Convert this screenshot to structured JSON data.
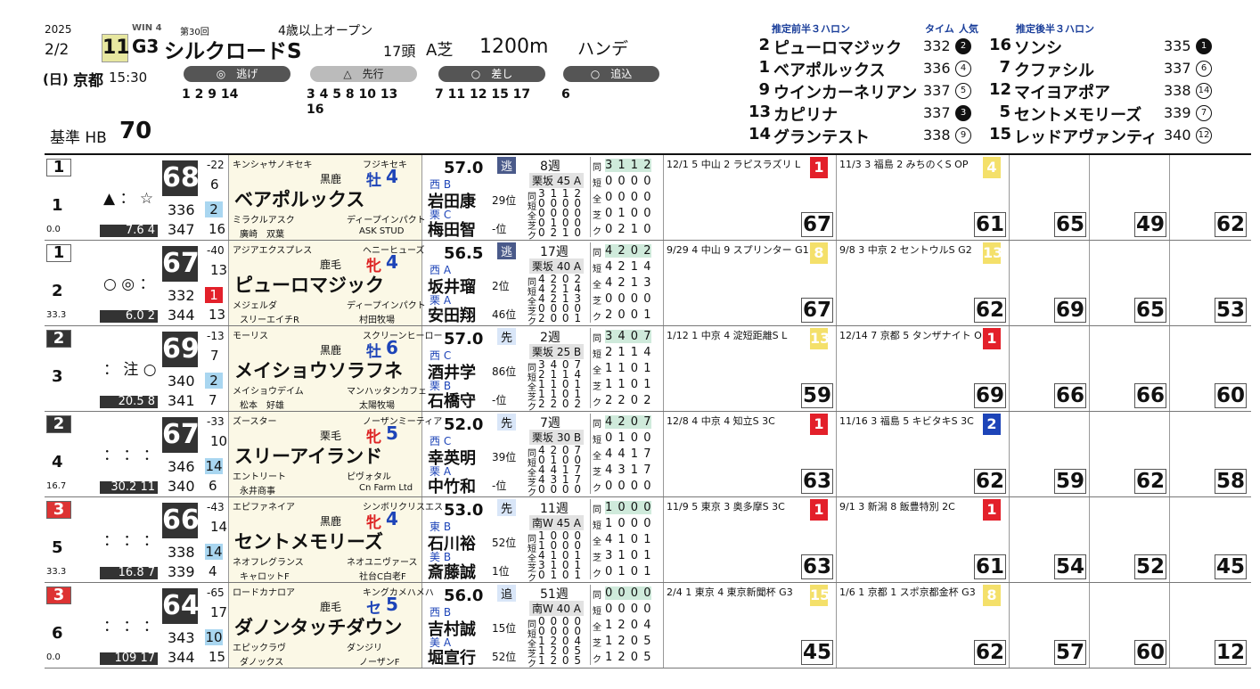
{
  "header": {
    "year": "2025",
    "date": "2/2",
    "day": "(日)",
    "venue": "京都",
    "time": "15:30",
    "win_label": "WIN 4",
    "edition": "第30回",
    "race_number": "11",
    "grade": "G3",
    "race_name": "シルクロードS",
    "conditions": "4歳以上オープン",
    "field": "17頭",
    "course_type": "A芝",
    "distance": "1200m",
    "weight_rule": "ハンデ",
    "base_label": "基準 HB",
    "base_value": "70"
  },
  "styles": [
    {
      "label": "◎　逃げ",
      "horses": "1 2 9 14"
    },
    {
      "label": "△　先行",
      "horses": "3 4 5 8 10 13 16"
    },
    {
      "label": "○　差し",
      "horses": "7 11 12 15 17"
    },
    {
      "label": "○　追込",
      "horses": "6"
    }
  ],
  "predictions": {
    "front_title": "推定前半３ハロン",
    "time_col": "タイム",
    "pop_col": "人気",
    "back_title": "推定後半３ハロン",
    "front": [
      {
        "num": "2",
        "name": "ピューロマジック",
        "time": "332",
        "pop": "2",
        "filled": true
      },
      {
        "num": "1",
        "name": "ベアポルックス",
        "time": "336",
        "pop": "4",
        "filled": false
      },
      {
        "num": "9",
        "name": "ウインカーネリアン",
        "time": "337",
        "pop": "5",
        "filled": false
      },
      {
        "num": "13",
        "name": "カピリナ",
        "time": "337",
        "pop": "3",
        "filled": true
      },
      {
        "num": "14",
        "name": "グランテスト",
        "time": "338",
        "pop": "9",
        "filled": false
      }
    ],
    "back": [
      {
        "num": "16",
        "name": "ソンシ",
        "time": "335",
        "pop": "1",
        "filled": true
      },
      {
        "num": "7",
        "name": "クファシル",
        "time": "337",
        "pop": "6",
        "filled": false
      },
      {
        "num": "12",
        "name": "マイヨアポア",
        "time": "338",
        "pop": "14",
        "filled": false
      },
      {
        "num": "5",
        "name": "セントメモリーズ",
        "time": "339",
        "pop": "7",
        "filled": false
      },
      {
        "num": "15",
        "name": "レッドアヴァンティ",
        "time": "340",
        "pop": "12",
        "filled": false
      }
    ]
  },
  "horses": [
    {
      "frame": "1",
      "num": "1",
      "marks": "▲ ： ☆",
      "odds": "7.6",
      "odds_rank": "4",
      "left_val": "0.0",
      "hb": "68",
      "hb_diff": "-22",
      "idx1": "336",
      "idx1b": "2",
      "idx2": "347",
      "idx2b": "16",
      "sub": "6",
      "sire": "キンシャサノキセキ",
      "dam_sire": "フジキセキ",
      "color": "黒鹿",
      "sex": "牡",
      "age": "4",
      "name": "ベアポルックス",
      "dam": "ミラクルアスク",
      "bms": "ディープインパクト",
      "owner": "廣崎　双葉",
      "breeder": "ASK STUD",
      "weight": "57.0",
      "j_region": "西 B",
      "jockey": "岩田康",
      "j_rank": "29",
      "t_region": "栗 C",
      "trainer": "梅田智",
      "t_rank": "-",
      "style": "逃",
      "weeks": "8週",
      "training": "栗坂 45 A",
      "rec": [
        "3 1 1 2",
        "0 0 0 0",
        "0 0 0 0",
        "0 1 0 0",
        "0 2 1 0"
      ],
      "p1_date": "12/1 5 中山 2 ラピスラズリ L",
      "p1_score": "67",
      "p1_rank": "1",
      "p2_date": "11/3 3 福島 2 みちのくS OP",
      "p2_score": "61",
      "p2_rank": "4",
      "m1": "65",
      "m2": "49",
      "m3": "62"
    },
    {
      "frame": "1",
      "num": "2",
      "marks": "○ ◎ ：",
      "odds": "6.0",
      "odds_rank": "2",
      "left_val": "33.3",
      "hb": "67",
      "hb_diff": "-40",
      "idx1": "332",
      "idx1b": "1",
      "idx2": "344",
      "idx2b": "13",
      "sub": "13",
      "sire": "アジアエクスプレス",
      "dam_sire": "ヘニーヒューズ",
      "color": "鹿毛",
      "sex": "牝",
      "age": "4",
      "name": "ピューロマジック",
      "dam": "メジェルダ",
      "bms": "ディープインパクト",
      "owner": "スリーエイチR",
      "breeder": "村田牧場",
      "weight": "56.5",
      "j_region": "西 A",
      "jockey": "坂井瑠",
      "j_rank": "2",
      "t_region": "栗 A",
      "trainer": "安田翔",
      "t_rank": "46",
      "style": "逃",
      "weeks": "17週",
      "training": "栗坂 40 A",
      "rec": [
        "4 2 0 2",
        "4 2 1 4",
        "4 2 1 3",
        "0 0 0 0",
        "2 0 0 1"
      ],
      "p1_date": "9/29 4 中山 9 スプリンター G1",
      "p1_score": "67",
      "p1_rank": "8",
      "p2_date": "9/8 3 中京 2 セントウルS G2",
      "p2_score": "62",
      "p2_rank": "13",
      "m1": "69",
      "m2": "65",
      "m3": "53"
    },
    {
      "frame": "2",
      "num": "3",
      "marks": "： 注 ○",
      "odds": "20.5",
      "odds_rank": "8",
      "left_val": "",
      "hb": "69",
      "hb_diff": "-13",
      "idx1": "340",
      "idx1b": "2",
      "idx2": "341",
      "idx2b": "7",
      "sub": "7",
      "sire": "モーリス",
      "dam_sire": "スクリーンヒーロー",
      "color": "黒鹿",
      "sex": "牡",
      "age": "6",
      "name": "メイショウソラフネ",
      "dam": "メイショウデイム",
      "bms": "マンハッタンカフェ",
      "owner": "松本　好雄",
      "breeder": "太陽牧場",
      "weight": "57.0",
      "j_region": "西 C",
      "jockey": "酒井学",
      "j_rank": "86",
      "t_region": "栗 B",
      "trainer": "石橋守",
      "t_rank": "-",
      "style": "先",
      "weeks": "2週",
      "training": "栗坂 25 B",
      "rec": [
        "3 4 0 7",
        "2 1 1 4",
        "1 1 0 1",
        "1 1 0 1",
        "2 2 0 2"
      ],
      "p1_date": "1/12 1 中京 4 淀短距離S L",
      "p1_score": "59",
      "p1_rank": "13",
      "p2_date": "12/14 7 京都 5 タンザナイト OP",
      "p2_score": "69",
      "p2_rank": "1",
      "m1": "66",
      "m2": "66",
      "m3": "60"
    },
    {
      "frame": "2",
      "num": "4",
      "marks": "： ： ：",
      "odds": "30.2",
      "odds_rank": "11",
      "left_val": "16.7",
      "hb": "67",
      "hb_diff": "-33",
      "idx1": "346",
      "idx1b": "14",
      "idx2": "340",
      "idx2b": "6",
      "sub": "10",
      "sire": "ズースター",
      "dam_sire": "ノーザンミーティア",
      "color": "栗毛",
      "sex": "牝",
      "age": "5",
      "name": "スリーアイランド",
      "dam": "エントリート",
      "bms": "ピヴォタル",
      "owner": "永井商事",
      "breeder": "Cn Farm Ltd",
      "weight": "52.0",
      "j_region": "西 C",
      "jockey": "幸英明",
      "j_rank": "39",
      "t_region": "栗 A",
      "trainer": "中竹和",
      "t_rank": "-",
      "style": "先",
      "weeks": "7週",
      "training": "栗坂 30 B",
      "rec": [
        "4 2 0 7",
        "0 1 0 0",
        "4 4 1 7",
        "4 3 1 7",
        "0 0 0 0"
      ],
      "p1_date": "12/8 4 中京 4 知立S 3C",
      "p1_score": "63",
      "p1_rank": "1",
      "p2_date": "11/16 3 福島 5 キビタキS 3C",
      "p2_score": "62",
      "p2_rank": "2",
      "m1": "59",
      "m2": "62",
      "m3": "58"
    },
    {
      "frame": "3",
      "num": "5",
      "marks": "： ： ：",
      "odds": "16.8",
      "odds_rank": "7",
      "left_val": "33.3",
      "hb": "66",
      "hb_diff": "-43",
      "idx1": "338",
      "idx1b": "14",
      "idx2": "339",
      "idx2b": "4",
      "sub": "14",
      "sire": "エピファネイア",
      "dam_sire": "シンボリクリスエス",
      "color": "黒鹿",
      "sex": "牝",
      "age": "4",
      "name": "セントメモリーズ",
      "dam": "ネオフレグランス",
      "bms": "ネオユニヴァース",
      "owner": "キャロットF",
      "breeder": "社台C白老F",
      "weight": "53.0",
      "j_region": "東 B",
      "jockey": "石川裕",
      "j_rank": "52",
      "t_region": "美 B",
      "trainer": "斎藤誠",
      "t_rank": "1",
      "style": "先",
      "weeks": "11週",
      "training": "南W 45 A",
      "rec": [
        "1 0 0 0",
        "1 0 0 0",
        "4 1 0 1",
        "3 1 0 1",
        "0 1 0 1"
      ],
      "p1_date": "11/9 5 東京 3 奥多摩S 3C",
      "p1_score": "63",
      "p1_rank": "1",
      "p2_date": "9/1 3 新潟 8 飯豊特別 2C",
      "p2_score": "61",
      "p2_rank": "1",
      "m1": "54",
      "m2": "52",
      "m3": "45"
    },
    {
      "frame": "3",
      "num": "6",
      "marks": "： ： ：",
      "odds": "109",
      "odds_rank": "17",
      "left_val": "0.0",
      "hb": "64",
      "hb_diff": "-65",
      "idx1": "343",
      "idx1b": "10",
      "idx2": "344",
      "idx2b": "15",
      "sub": "17",
      "sire": "ロードカナロア",
      "dam_sire": "キングカメハメハ",
      "color": "鹿毛",
      "sex": "セ",
      "age": "5",
      "name": "ダノンタッチダウン",
      "dam": "エピックラヴ",
      "bms": "ダンジリ",
      "owner": "ダノックス",
      "breeder": "ノーザンF",
      "weight": "56.0",
      "j_region": "西 B",
      "jockey": "吉村誠",
      "j_rank": "15",
      "t_region": "美 A",
      "trainer": "堀宣行",
      "t_rank": "52",
      "style": "追",
      "weeks": "51週",
      "training": "南W 40 A",
      "rec": [
        "0 0 0 0",
        "0 0 0 0",
        "1 2 0 4",
        "1 2 0 5",
        "1 2 0 5"
      ],
      "p1_date": "2/4 1 東京 4 東京新聞杯 G3",
      "p1_score": "45",
      "p1_rank": "15",
      "p2_date": "1/6 1 京都 1 スポ京都金杯 G3",
      "p2_score": "62",
      "p2_rank": "8",
      "m1": "57",
      "m2": "60",
      "m3": "12"
    }
  ]
}
